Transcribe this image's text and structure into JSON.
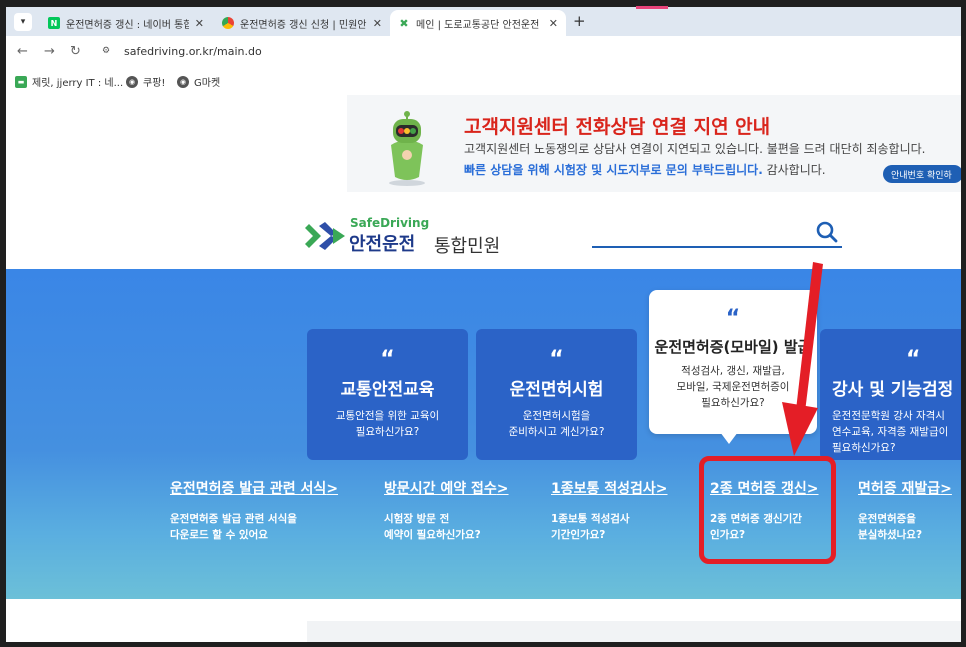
{
  "tabs": [
    {
      "title": "운전면허증 갱신 : 네이버 통합",
      "favicon": "naver-icon",
      "active": false
    },
    {
      "title": "운전면허증 갱신 신청 | 민원안",
      "favicon": "chrome-icon",
      "active": false
    },
    {
      "title": "메인 | 도로교통공단 안전운전",
      "favicon": "safedriving-icon",
      "active": true
    }
  ],
  "toolbar": {
    "url": "safedriving.or.kr/main.do"
  },
  "bookmarks": [
    {
      "label": "제릿, jjerry IT : 네...",
      "icon": "bookmark-green-icon"
    },
    {
      "label": "쿠팡!",
      "icon": "globe-icon"
    },
    {
      "label": "G마켓",
      "icon": "globe-icon"
    }
  ],
  "banner": {
    "title": "고객지원센터 전화상담 연결 지연 안내",
    "line1": "고객지원센터 노동쟁의로 상담사 연결이 지연되고 있습니다. 불편을 드려 대단히 죄송합니다.",
    "line2_highlight": "빠른 상담을 위해 시험장 및 시도지부로 문의 부탁드립니다.",
    "line2_rest": " 감사합니다.",
    "button": "안내번호 확인하"
  },
  "header": {
    "logo_en": "SafeDriving",
    "logo_ko": "안전운전",
    "logo_sub": "통합민원"
  },
  "cards": [
    {
      "quote": "“",
      "title": "교통안전교육",
      "desc1": "교통안전을 위한 교육이",
      "desc2": "필요하신가요?"
    },
    {
      "quote": "“",
      "title": "운전면허시험",
      "desc1": "운전면허시험을",
      "desc2": "준비하시고 계신가요?"
    },
    {
      "quote": "“",
      "title": "운전면허증(모바일) 발급",
      "desc1": "적성검사, 갱신, 재발급,",
      "desc2": "모바일, 국제운전면허증이",
      "desc3": "필요하신가요?"
    },
    {
      "quote": "“",
      "title": "강사 및 기능검정",
      "desc1": "운전전문학원 강사 자격시",
      "desc2": "연수교육, 자격증 재발급이",
      "desc3": "필요하신가요?"
    }
  ],
  "links": [
    {
      "title": "운전면허증 발급 관련 서식",
      "arrow": ">",
      "desc1": "운전면허증 발급 관련 서식을",
      "desc2": "다운로드 할 수 있어요"
    },
    {
      "title": "방문시간 예약 접수",
      "arrow": ">",
      "desc1": "시험장 방문 전",
      "desc2": "예약이 필요하신가요?"
    },
    {
      "title": "1종보통 적성검사",
      "arrow": ">",
      "desc1": "1종보통 적성검사",
      "desc2": "기간인가요?"
    },
    {
      "title": "2종 면허증 갱신",
      "arrow": ">",
      "desc1": "2종 면허증 갱신기간",
      "desc2": "인가요?"
    },
    {
      "title": "면허증 재발급",
      "arrow": ">",
      "desc1": "운전면허증을",
      "desc2": "분실하셨나요?"
    }
  ],
  "annotation": {
    "highlight_color": "#e41e26"
  },
  "colors": {
    "brand_blue": "#2b63c7",
    "brand_green": "#3aa856",
    "banner_red": "#d9251c"
  }
}
